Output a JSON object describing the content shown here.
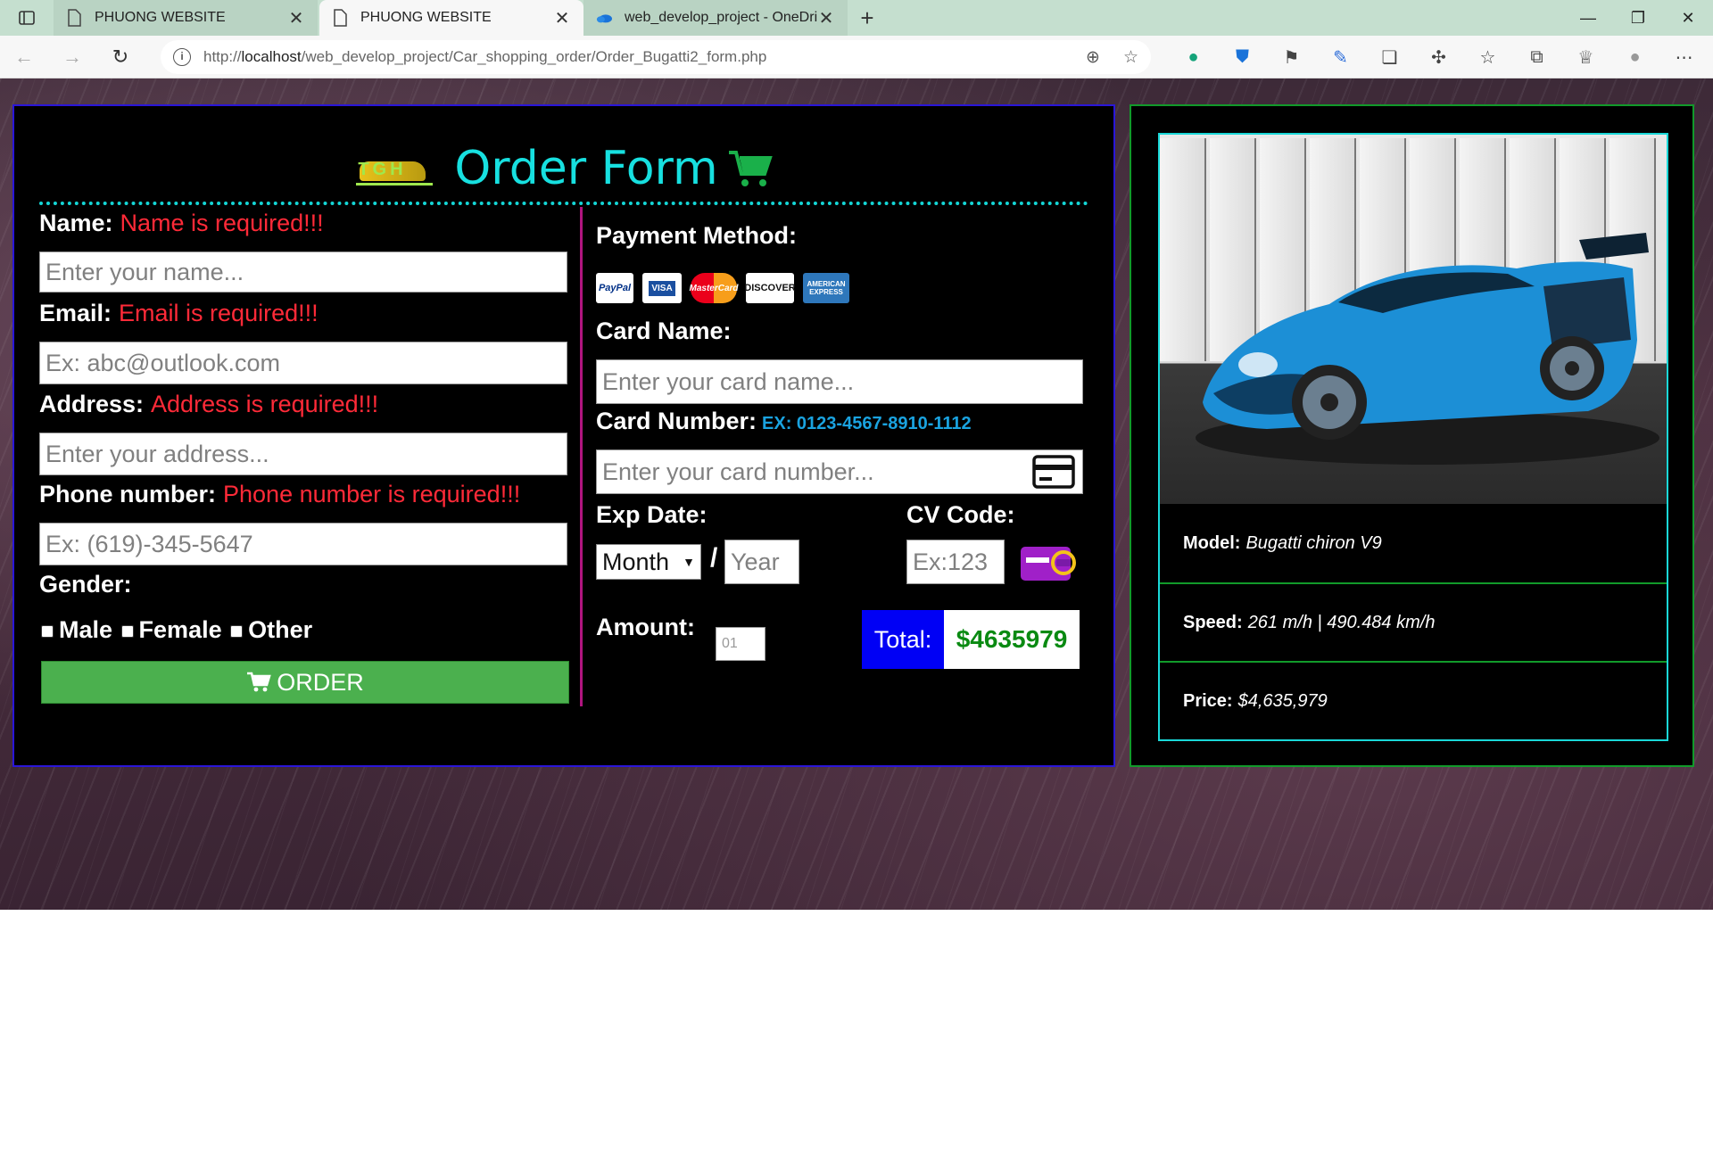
{
  "browser": {
    "tabs": [
      {
        "title": "PHUONG WEBSITE",
        "active": false
      },
      {
        "title": "PHUONG WEBSITE",
        "active": true
      },
      {
        "title": "web_develop_project - OneDrive",
        "active": false
      }
    ],
    "url_prefix": "http://",
    "url_host": "localhost",
    "url_path": "/web_develop_project/Car_shopping_order/Order_Bugatti2_form.php"
  },
  "form": {
    "logo_text": "TGH",
    "title": "Order Form",
    "name_label": "Name:",
    "name_error": "Name is required!!!",
    "name_placeholder": "Enter your name...",
    "email_label": "Email:",
    "email_error": "Email is required!!!",
    "email_placeholder": "Ex: abc@outlook.com",
    "address_label": "Address:",
    "address_error": "Address is required!!!",
    "address_placeholder": "Enter your address...",
    "phone_label": "Phone number:",
    "phone_error": "Phone number is required!!!",
    "phone_placeholder": "Ex: (619)-345-5647",
    "gender_label": "Gender:",
    "gender_options": [
      "Male",
      "Female",
      "Other"
    ],
    "order_button": "ORDER",
    "payment_label": "Payment Method:",
    "payment_icons": [
      "PayPal",
      "VISA",
      "MasterCard",
      "DISCOVER",
      "AMERICAN EXPRESS"
    ],
    "card_name_label": "Card Name:",
    "card_name_placeholder": "Enter your card name...",
    "card_number_label": "Card Number:",
    "card_number_hint": "EX: 0123-4567-8910-1112",
    "card_number_placeholder": "Enter your card number...",
    "exp_label": "Exp Date:",
    "exp_month": "Month",
    "exp_sep": "/",
    "exp_year_placeholder": "Year",
    "cv_label": "CV Code:",
    "cv_placeholder": "Ex:123",
    "amount_label": "Amount:",
    "amount_placeholder": "01",
    "total_label": "Total:",
    "total_value": "$4635979"
  },
  "product": {
    "model_label": "Model:",
    "model_value": "Bugatti chiron V9",
    "speed_label": "Speed:",
    "speed_value": "261 m/h | 490.484 km/h",
    "price_label": "Price:",
    "price_value": "$4,635,979"
  },
  "colors": {
    "title": "#17e0e0",
    "error": "#ff2a38",
    "order_button": "#4bb04e",
    "total_label_bg": "#0000f5",
    "total_value": "#0a8a12",
    "form_border": "#2a16d8",
    "product_border": "#119a2a"
  }
}
